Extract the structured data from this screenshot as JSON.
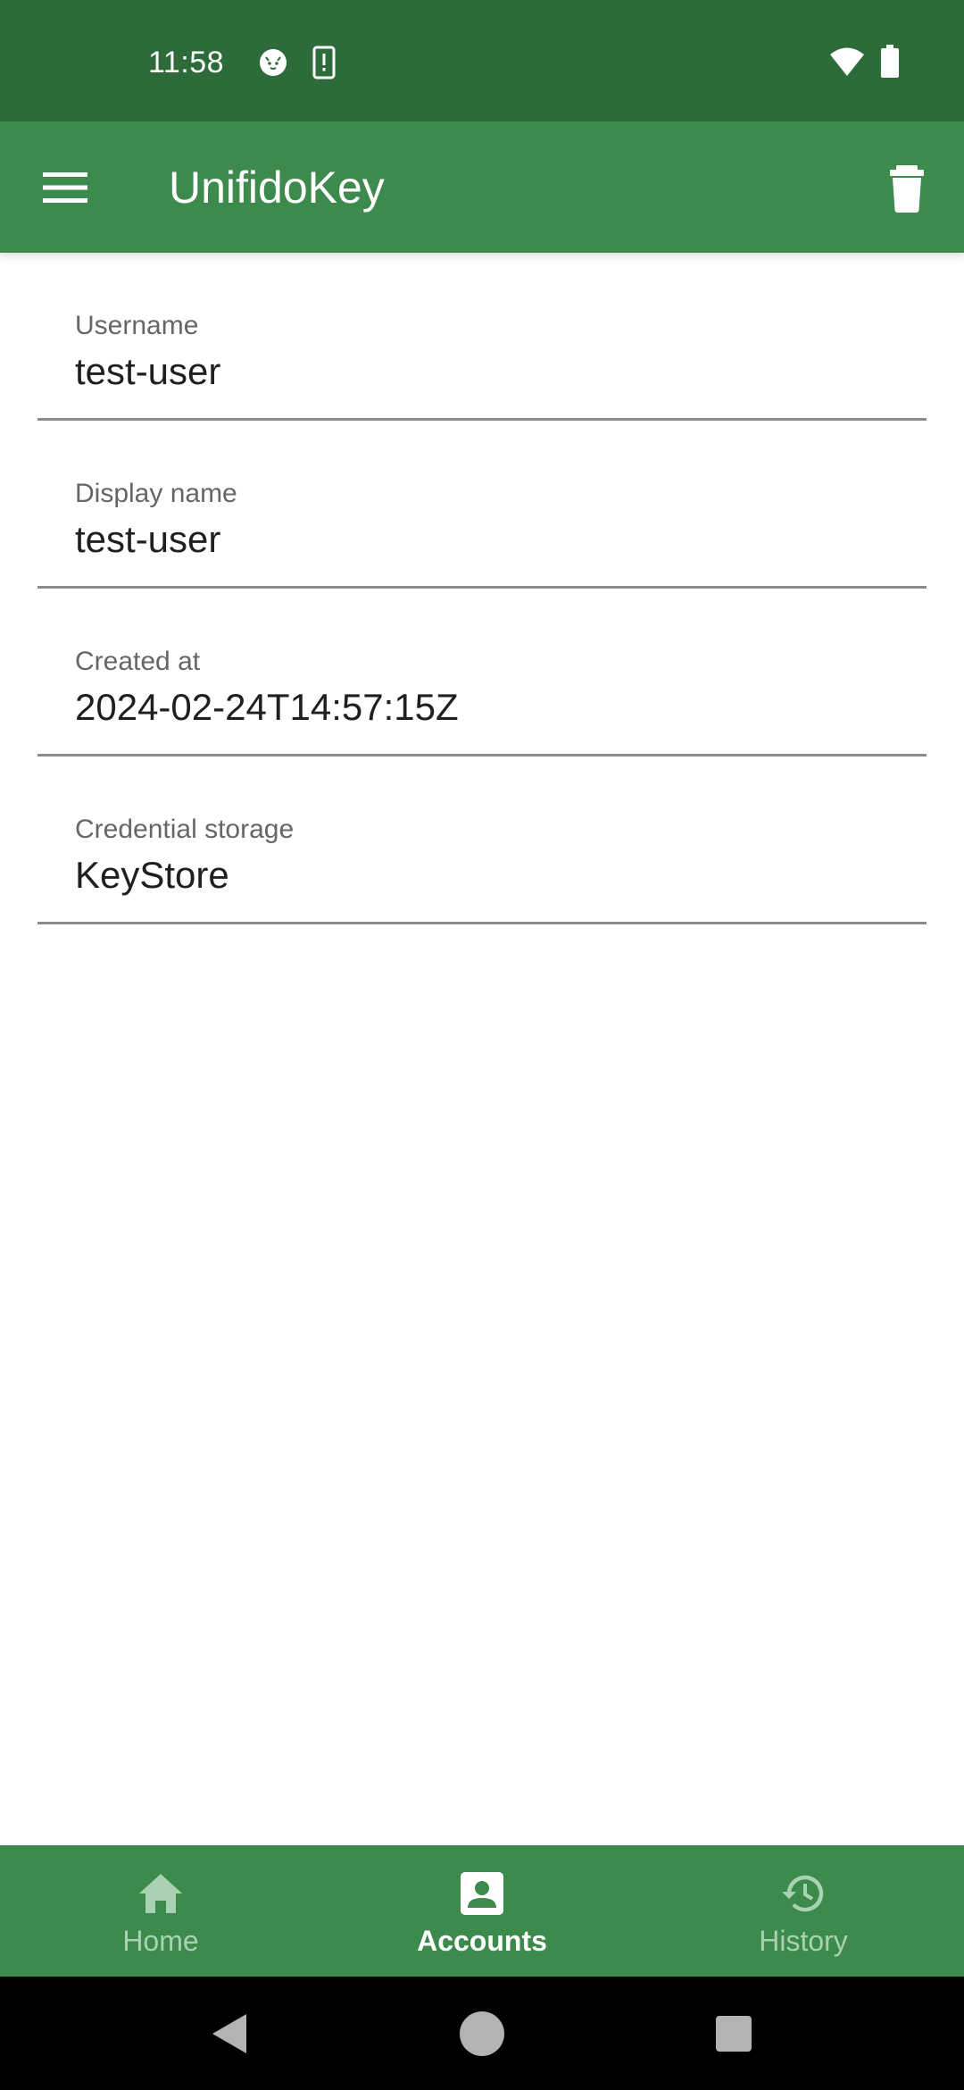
{
  "status_bar": {
    "time": "11:58",
    "icons": [
      "cat-notification-icon",
      "device-alert-icon",
      "wifi-icon",
      "battery-icon"
    ]
  },
  "app_bar": {
    "title": "UnifidoKey",
    "menu_icon": "menu-icon",
    "delete_icon": "trash-icon"
  },
  "fields": [
    {
      "label": "Username",
      "value": "test-user"
    },
    {
      "label": "Display name",
      "value": "test-user"
    },
    {
      "label": "Created at",
      "value": "2024-02-24T14:57:15Z"
    },
    {
      "label": "Credential storage",
      "value": "KeyStore"
    }
  ],
  "bottom_nav": {
    "items": [
      {
        "label": "Home",
        "icon": "home-icon",
        "active": false
      },
      {
        "label": "Accounts",
        "icon": "account-box-icon",
        "active": true
      },
      {
        "label": "History",
        "icon": "history-icon",
        "active": false
      }
    ]
  },
  "colors": {
    "status_bar": "#2e6b3b",
    "primary": "#3d8a4d",
    "nav_inactive": "#a9d1b2",
    "nav_active": "#ffffff"
  }
}
